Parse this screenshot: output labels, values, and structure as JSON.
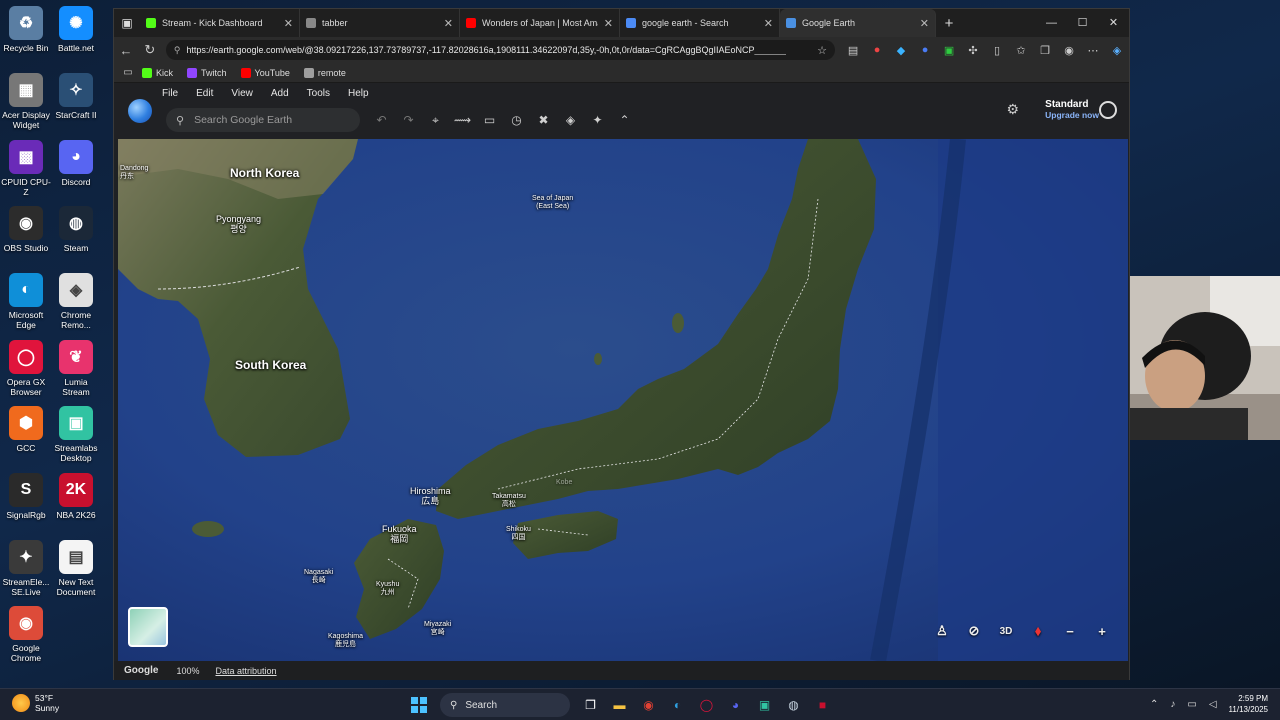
{
  "desktop": {
    "icons": [
      {
        "label": "Recycle Bin",
        "icon": "recycle-bin-icon",
        "color": "#5a7ea3"
      },
      {
        "label": "Battle.net",
        "icon": "battlenet-icon",
        "color": "#148eff"
      },
      {
        "label": "Acer Display Widget",
        "icon": "acer-display-icon",
        "color": "#777777"
      },
      {
        "label": "StarCraft II",
        "icon": "starcraft-icon",
        "color": "#2a4f75"
      },
      {
        "label": "CPUID CPU-Z",
        "icon": "cpuz-icon",
        "color": "#6a2bb8"
      },
      {
        "label": "Discord",
        "icon": "discord-icon",
        "color": "#5865f2"
      },
      {
        "label": "OBS Studio",
        "icon": "obs-icon",
        "color": "#2c2c2c"
      },
      {
        "label": "Steam",
        "icon": "steam-icon",
        "color": "#1b2838"
      },
      {
        "label": "Microsoft Edge",
        "icon": "edge-icon",
        "color": "#0f8fd8"
      },
      {
        "label": "Chrome Remo...",
        "icon": "chrome-remote-icon",
        "color": "#e0e0e0"
      },
      {
        "label": "Opera GX Browser",
        "icon": "opera-gx-icon",
        "color": "#e0143c"
      },
      {
        "label": "Lumia Stream",
        "icon": "lumia-icon",
        "color": "#e8336d"
      },
      {
        "label": "GCC",
        "icon": "gcc-icon",
        "color": "#f06a1d"
      },
      {
        "label": "Streamlabs Desktop",
        "icon": "streamlabs-icon",
        "color": "#31c3a2"
      },
      {
        "label": "SignalRgb",
        "icon": "signalrgb-icon",
        "color": "#2a2a2a"
      },
      {
        "label": "NBA 2K26",
        "icon": "nba2k-icon",
        "color": "#c8102e"
      },
      {
        "label": "StreamEle... SE.Live",
        "icon": "streamelements-icon",
        "color": "#3a3a3a"
      },
      {
        "label": "New Text Document",
        "icon": "text-document-icon",
        "color": "#f4f4f4"
      },
      {
        "label": "Google Chrome",
        "icon": "chrome-icon",
        "color": "#dd4b39"
      }
    ]
  },
  "browser": {
    "tabs": [
      {
        "label": "Stream - Kick Dashboard",
        "color": "#53fc18",
        "active": false
      },
      {
        "label": "tabber",
        "color": "#888888",
        "active": false
      },
      {
        "label": "Wonders of Japan | Most Amazin",
        "color": "#ff0000",
        "active": false
      },
      {
        "label": "google earth - Search",
        "color": "#4c8bf5",
        "active": false
      },
      {
        "label": "Google Earth",
        "color": "#4a90e2",
        "active": true
      }
    ],
    "url": "https://earth.google.com/web/@38.09217226,137.73789737,-117.82028616a,1908111.34622097d,35y,-0h,0t,0r/data=CgRCAggBQgIIAEoNCP_________",
    "bookmarks": [
      {
        "label": "Kick",
        "color": "#53fc18"
      },
      {
        "label": "Twitch",
        "color": "#9146ff"
      },
      {
        "label": "YouTube",
        "color": "#ff0000"
      },
      {
        "label": "remote",
        "color": "#9e9e9e"
      }
    ]
  },
  "earth": {
    "menu": [
      "File",
      "Edit",
      "View",
      "Add",
      "Tools",
      "Help"
    ],
    "search_placeholder": "Search Google Earth",
    "plan": "Standard",
    "upgrade": "Upgrade now",
    "map_labels": {
      "dandong": "Dandong\n丹东",
      "north_korea": "North Korea",
      "pyongyang": "Pyongyang\n평양",
      "south_korea": "South Korea",
      "sea_of_japan": "Sea of Japan\n(East Sea)",
      "hiroshima": "Hiroshima\n広島",
      "takamatsu": "Takamatsu\n高松",
      "kobe": "Kobe",
      "shikoku": "Shikoku\n四国",
      "fukuoka": "Fukuoka\n福岡",
      "nagasaki": "Nagasaki\n長崎",
      "kyushu": "Kyushu\n九州",
      "miyazaki": "Miyazaki\n宮崎",
      "kagoshima": "Kagoshima\n鹿児島"
    },
    "controls": {
      "view_3d": "3D"
    },
    "status": {
      "brand": "Google",
      "zoom": "100%",
      "attribution": "Data attribution"
    }
  },
  "taskbar": {
    "weather_temp": "53°F",
    "weather_desc": "Sunny",
    "search_placeholder": "Search",
    "time": "2:59 PM",
    "date": "11/13/2025"
  }
}
